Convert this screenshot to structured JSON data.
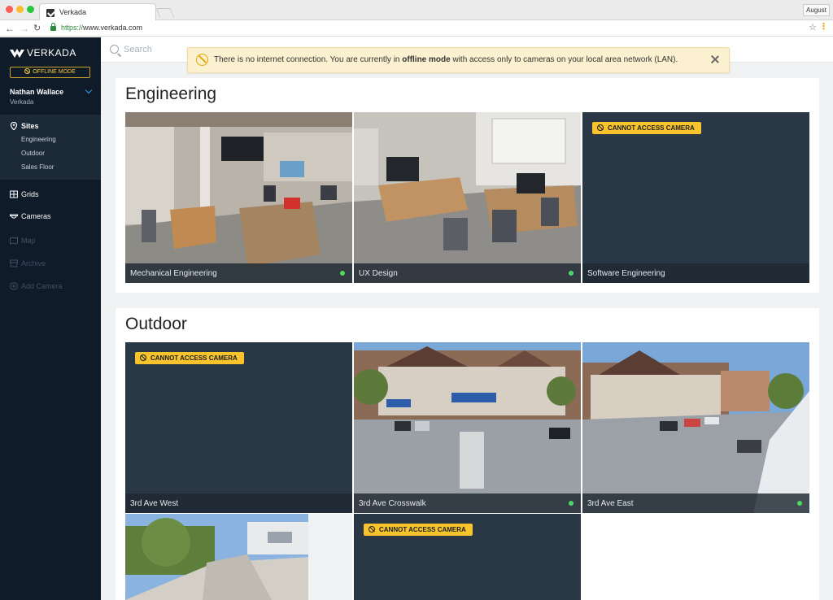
{
  "browser": {
    "tab_title": "Verkada",
    "url_scheme": "https://",
    "url_host": "www.verkada.com",
    "profile_name": "August"
  },
  "sidebar": {
    "brand": "VERKADA",
    "offline_badge": "OFFLINE MODE",
    "user_name": "Nathan Wallace",
    "user_org": "Verkada",
    "sites_label": "Sites",
    "sites": [
      "Engineering",
      "Outdoor",
      "Sales Floor"
    ],
    "nav": {
      "grids": "Grids",
      "cameras": "Cameras",
      "map": "Map",
      "archive": "Archive",
      "add_camera": "Add Camera"
    }
  },
  "search": {
    "placeholder": "Search"
  },
  "alert": {
    "text_before": "There is no internet connection. You are currently in ",
    "text_bold": "offline mode",
    "text_after": " with access only to cameras on your local area network (LAN)."
  },
  "groups": [
    {
      "title": "Engineering",
      "cameras": [
        {
          "name": "Mechanical Engineering",
          "online": true
        },
        {
          "name": "UX Design",
          "online": true
        },
        {
          "name": "Software Engineering",
          "online": false,
          "badge": "CANNOT ACCESS CAMERA"
        }
      ]
    },
    {
      "title": "Outdoor",
      "cameras": [
        {
          "name": "3rd Ave West",
          "online": false,
          "badge": "CANNOT ACCESS CAMERA"
        },
        {
          "name": "3rd Ave Crosswalk",
          "online": true
        },
        {
          "name": "3rd Ave East",
          "online": true
        },
        {
          "name": "",
          "online": true
        },
        {
          "name": "",
          "online": false,
          "badge": "CANNOT ACCESS CAMERA"
        }
      ]
    }
  ],
  "colors": {
    "sidebar_bg": "#0f1b28",
    "accent_yellow": "#f8c32b",
    "online_green": "#4cd964",
    "tile_offline_bg": "#2a3744"
  }
}
